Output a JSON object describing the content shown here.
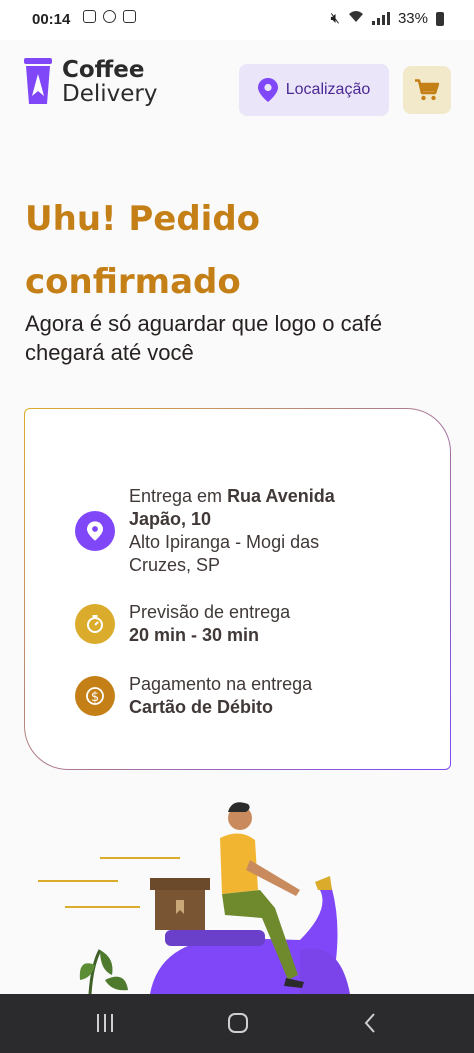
{
  "status_bar": {
    "time": "00:14",
    "battery": "33%"
  },
  "brand": {
    "line1": "Coffee",
    "line2": "Delivery"
  },
  "header": {
    "location_label": "Localização"
  },
  "confirmation": {
    "title_line1": "Uhu! Pedido",
    "title_line2": "confirmado",
    "subtitle": "Agora é só aguardar que logo o café chegará até você"
  },
  "order_info": {
    "delivery_prefix": "Entrega em ",
    "street": "Rua Avenida Japão, 10",
    "district": "Alto Ipiranga - Mogi das Cruzes, SP",
    "eta_label": "Previsão de entrega",
    "eta_value": "20 min - 30 min",
    "payment_label": "Pagamento na entrega",
    "payment_value": "Cartão de Débito"
  },
  "colors": {
    "purple": "#8047f8",
    "yellow": "#dbac2c",
    "yellow_dark": "#c47f17",
    "purple_dark": "#4b2995"
  },
  "icons": {
    "delivery": "map-pin-icon",
    "eta": "timer-icon",
    "payment": "currency-dollar-icon"
  }
}
